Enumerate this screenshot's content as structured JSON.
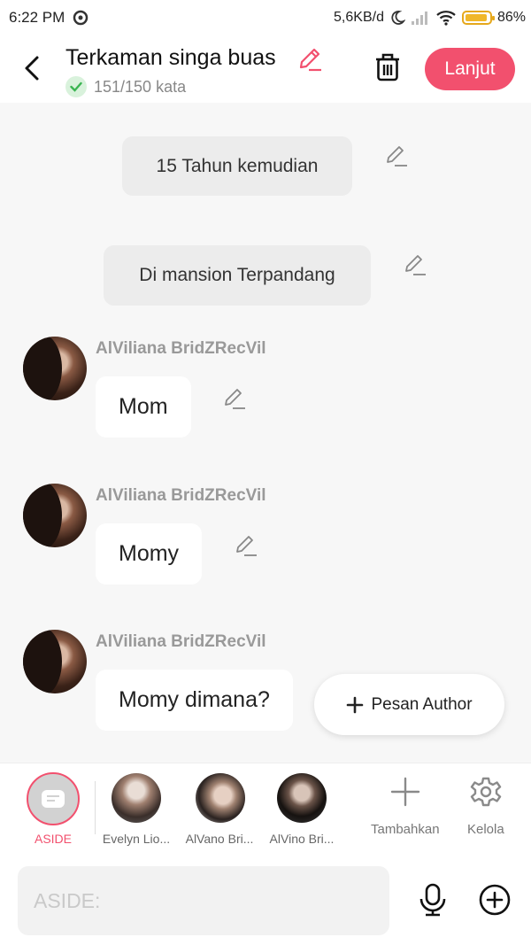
{
  "status": {
    "time": "6:22 PM",
    "speed": "5,6KB/d",
    "battery": "86%"
  },
  "header": {
    "title": "Terkaman singa buas",
    "word_count": "151/150 kata",
    "next_label": "Lanjut"
  },
  "scenes": [
    "15 Tahun kemudian",
    "Di mansion Terpandang"
  ],
  "messages": [
    {
      "speaker": "AlViliana BridZRecVil",
      "text": "Mom"
    },
    {
      "speaker": "AlViliana BridZRecVil",
      "text": "Momy"
    },
    {
      "speaker": "AlViliana BridZRecVil",
      "text": "Momy dimana?"
    }
  ],
  "fab": {
    "label": "Pesan Author"
  },
  "characters": {
    "aside_label": "ASIDE",
    "items": [
      {
        "label": "Evelyn Lio..."
      },
      {
        "label": "AlVano Bri..."
      },
      {
        "label": "AlVino Bri..."
      }
    ],
    "add_label": "Tambahkan",
    "manage_label": "Kelola"
  },
  "input": {
    "placeholder": "ASIDE:"
  },
  "colors": {
    "accent": "#f2506e",
    "check": "#3bb552"
  }
}
